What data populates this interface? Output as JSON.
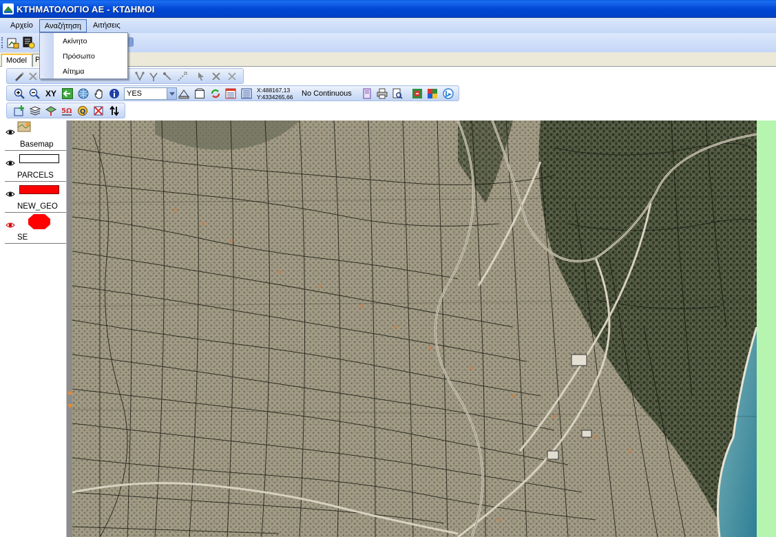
{
  "window": {
    "title": "ΚΤΗΜΑΤΟΛΟΓΙΟ ΑΕ - ΚΤΔΗΜΟΙ"
  },
  "menubar": {
    "items": [
      "Αρχείο",
      "Αναζήτηση",
      "Αιτήσεις"
    ]
  },
  "search_menu": {
    "items": [
      "Ακίνητο",
      "Πρόσωπο",
      "Αίτημα"
    ]
  },
  "tabs": [
    {
      "label": "Model",
      "active": true
    },
    {
      "label": "P",
      "active": false
    }
  ],
  "navigation_toolbar": {
    "xy_label": "XY",
    "snap_combo_value": "YES",
    "coord_x": "X:488167,13",
    "coord_y": "Y:4334265,66",
    "trace_mode": "No Continuous"
  },
  "layers": [
    {
      "name": "Basemap",
      "swatch": "basemap-icon"
    },
    {
      "name": "PARCELS",
      "swatch": "#ffffff",
      "border": "#000000"
    },
    {
      "name": "NEW_GEO",
      "swatch": "#ff0000",
      "border": "#800000"
    },
    {
      "name": "SE",
      "swatch": "#ff0000",
      "shape": "octagon"
    }
  ],
  "colors": {
    "titlebar": "#0047d4",
    "menubar": "#c5d7f7",
    "right_strip": "#b5f5b0",
    "sea": "#4a96a8"
  }
}
